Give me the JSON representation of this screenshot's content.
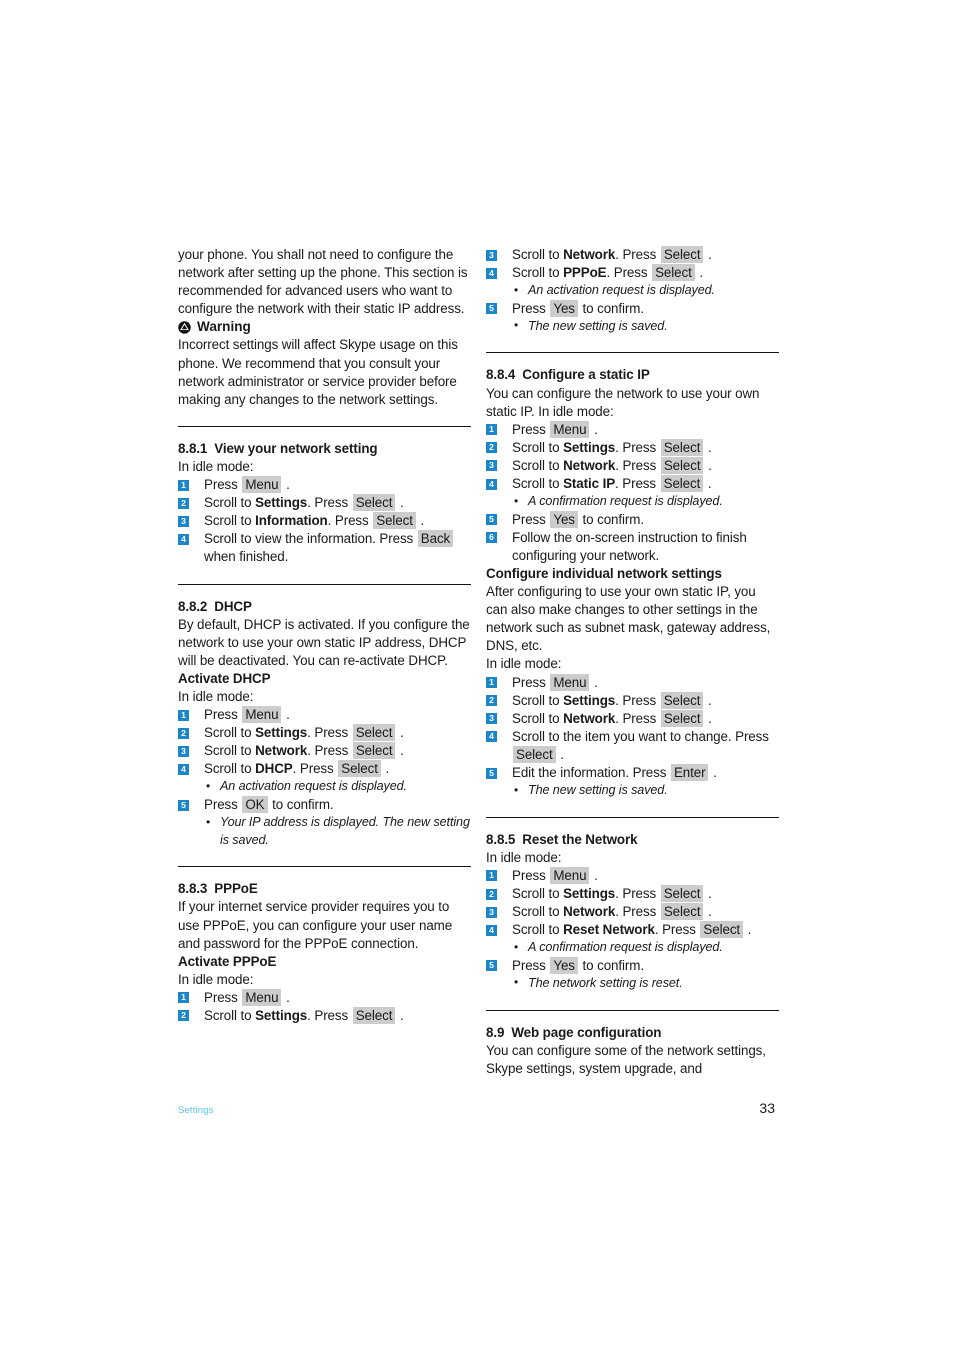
{
  "page": {
    "footer_label": "Settings",
    "page_number": "33",
    "accent_blue": "#1b87c9",
    "key_gray": "#cccccc",
    "footer_blue": "#5cc1ef"
  },
  "left_column": {
    "intro_paragraph": "your phone. You shall not need to configure the network after setting up the phone. This section is recommended for advanced users who want to configure the network with their static IP address.",
    "warning": {
      "icon": "warning-triangle-circle-icon",
      "title": "Warning",
      "body": "Incorrect settings will affect Skype usage on this phone. We recommend that you consult your network administrator or service provider before making any changes to the network settings."
    },
    "section_881": {
      "number": "8.8.1",
      "title": "View your network setting",
      "lead": "In idle mode:",
      "steps": [
        {
          "n": "1",
          "pre": "Press ",
          "key1": "Menu",
          "mid": " .",
          "bold": "",
          "post": ""
        },
        {
          "n": "2",
          "pre": "Scroll to ",
          "bold": "Settings",
          "mid": ". Press ",
          "key1": "Select",
          "post": " ."
        },
        {
          "n": "3",
          "pre": "Scroll to ",
          "bold": "Information",
          "mid": ". Press ",
          "key1": "Select",
          "post": " ."
        },
        {
          "n": "4",
          "pre": "Scroll to view the information. Press ",
          "key1": "Back",
          "post": "",
          "cont": "when finished."
        }
      ]
    },
    "section_882": {
      "number": "8.8.2",
      "title": "DHCP",
      "body": "By default, DHCP is activated. If you configure the network to use your own static IP address, DHCP will be deactivated. You can re-activate DHCP.",
      "subheading": "Activate DHCP",
      "lead": "In idle mode:",
      "steps": [
        {
          "n": "1",
          "pre": "Press ",
          "key1": "Menu",
          "post": " ."
        },
        {
          "n": "2",
          "pre": "Scroll to ",
          "bold": "Settings",
          "mid": ". Press ",
          "key1": "Select",
          "post": " ."
        },
        {
          "n": "3",
          "pre": "Scroll to ",
          "bold": "Network",
          "mid": ". Press ",
          "key1": "Select",
          "post": " ."
        },
        {
          "n": "4",
          "pre": "Scroll to ",
          "bold": "DHCP",
          "mid": ". Press ",
          "key1": "Select",
          "post": " ."
        }
      ],
      "note_after_4": "An activation request is displayed.",
      "step5": {
        "n": "5",
        "pre": "Press ",
        "key1": "OK",
        "post": " to confirm."
      },
      "note_after_5": "Your IP address is displayed. The new setting is saved."
    },
    "section_883": {
      "number": "8.8.3",
      "title": "PPPoE",
      "body": "If your internet service provider requires you to use PPPoE, you can configure your user name and password for the PPPoE connection.",
      "subheading": "Activate PPPoE",
      "lead": "In idle mode:",
      "steps": [
        {
          "n": "1",
          "pre": "Press ",
          "key1": "Menu",
          "post": " ."
        },
        {
          "n": "2",
          "pre": "Scroll to ",
          "bold": "Settings",
          "mid": ". Press ",
          "key1": "Select",
          "post": " ."
        }
      ]
    }
  },
  "right_column": {
    "continued_steps": [
      {
        "n": "3",
        "pre": "Scroll to ",
        "bold": "Network",
        "mid": ". Press ",
        "key1": "Select",
        "post": " ."
      },
      {
        "n": "4",
        "pre": "Scroll to ",
        "bold": "PPPoE",
        "mid": ". Press ",
        "key1": "Select",
        "post": " ."
      }
    ],
    "note_after_4": "An activation request is displayed.",
    "step5": {
      "n": "5",
      "pre": "Press ",
      "key1": "Yes",
      "post": " to confirm."
    },
    "note_after_5": "The new setting is saved.",
    "section_884": {
      "number": "8.8.4",
      "title": "Configure a static IP",
      "body": "You can configure the network to use your own static IP. In idle mode:",
      "steps": [
        {
          "n": "1",
          "pre": "Press ",
          "key1": "Menu",
          "post": " ."
        },
        {
          "n": "2",
          "pre": "Scroll to ",
          "bold": "Settings",
          "mid": ". Press ",
          "key1": "Select",
          "post": " ."
        },
        {
          "n": "3",
          "pre": "Scroll to ",
          "bold": "Network",
          "mid": ". Press ",
          "key1": "Select",
          "post": " ."
        },
        {
          "n": "4",
          "pre": "Scroll to ",
          "bold": "Static IP",
          "mid": ". Press ",
          "key1": "Select",
          "post": " ."
        }
      ],
      "note_after_4": "A confirmation request is displayed.",
      "step5": {
        "n": "5",
        "pre": "Press ",
        "key1": "Yes",
        "post": " to confirm."
      },
      "step6": {
        "n": "6",
        "text": "Follow the on-screen instruction to finish configuring your network."
      },
      "subheading": "Configure individual network settings",
      "sub_body": "After configuring to use your own static IP, you can also make changes to other settings in the network such as subnet mask, gateway address, DNS, etc.",
      "lead": "In idle mode:",
      "sub_steps": [
        {
          "n": "1",
          "pre": "Press ",
          "key1": "Menu",
          "post": " ."
        },
        {
          "n": "2",
          "pre": "Scroll to ",
          "bold": "Settings",
          "mid": ". Press ",
          "key1": "Select",
          "post": " ."
        },
        {
          "n": "3",
          "pre": "Scroll to ",
          "bold": "Network",
          "mid": ". Press ",
          "key1": "Select",
          "post": " ."
        }
      ],
      "sub_step4": {
        "n": "4",
        "pre": "Scroll to the item you want to change. Press ",
        "key1": "Select",
        "post": " ."
      },
      "sub_step5": {
        "n": "5",
        "pre": "Edit the information. Press ",
        "key1": "Enter",
        "post": " ."
      },
      "sub_note": "The new setting is saved."
    },
    "section_885": {
      "number": "8.8.5",
      "title": "Reset the Network",
      "lead": "In idle mode:",
      "steps": [
        {
          "n": "1",
          "pre": "Press ",
          "key1": "Menu",
          "post": " ."
        },
        {
          "n": "2",
          "pre": "Scroll to ",
          "bold": "Settings",
          "mid": ". Press ",
          "key1": "Select",
          "post": " ."
        },
        {
          "n": "3",
          "pre": "Scroll to ",
          "bold": "Network",
          "mid": ". Press ",
          "key1": "Select",
          "post": " ."
        },
        {
          "n": "4",
          "pre": "Scroll to ",
          "bold": "Reset Network",
          "mid": ". Press ",
          "key1": "Select",
          "post": " ."
        }
      ],
      "note_after_4": "A confirmation request is displayed.",
      "step5": {
        "n": "5",
        "pre": "Press ",
        "key1": "Yes",
        "post": " to confirm."
      },
      "note_after_5": "The network setting is reset."
    },
    "section_89": {
      "number": "8.9",
      "title": "Web page configuration",
      "body": "You can configure some of the network settings, Skype settings, system upgrade, and"
    }
  }
}
